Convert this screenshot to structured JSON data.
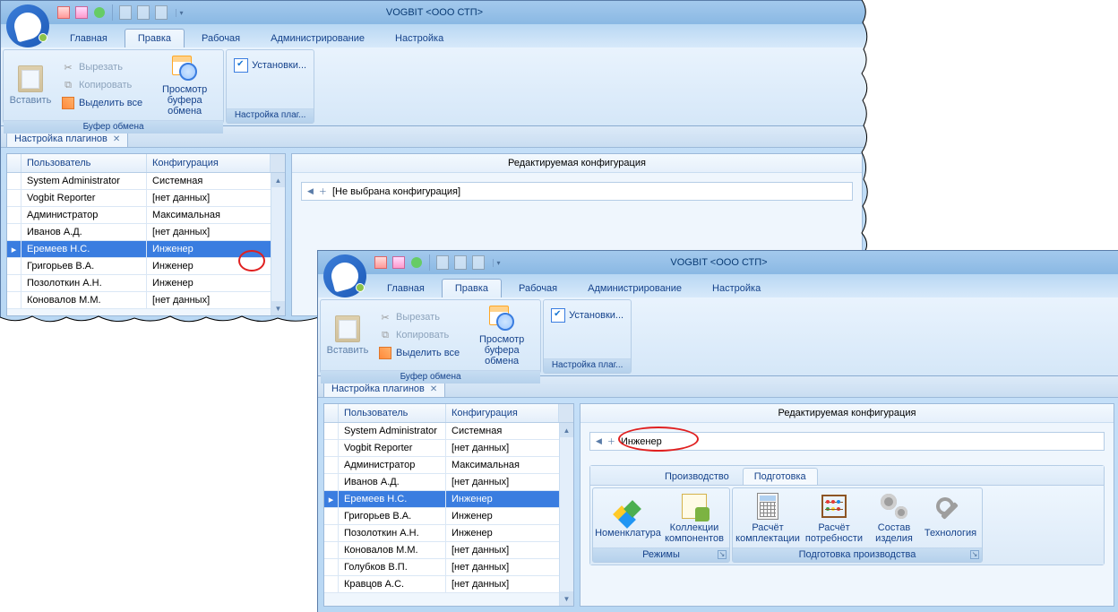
{
  "app_title": "VOGBIT <ООО СТП>",
  "main_tabs": [
    "Главная",
    "Правка",
    "Рабочая",
    "Администрирование",
    "Настройка"
  ],
  "active_main_tab": "Правка",
  "ribbon": {
    "paste": "Вставить",
    "cut": "Вырезать",
    "copy": "Копировать",
    "select_all": "Выделить все",
    "clipboard_group": "Буфер обмена",
    "preview": "Просмотр буфера обмена",
    "settings_btn": "Установки...",
    "settings_group": "Настройка плаг..."
  },
  "doc_tab": "Настройка плагинов",
  "grid": {
    "col_user": "Пользователь",
    "col_conf": "Конфигурация",
    "rows_w1": [
      {
        "user": "System Administrator",
        "conf": "Системная"
      },
      {
        "user": "Vogbit Reporter",
        "conf": "[нет данных]"
      },
      {
        "user": "Администратор",
        "conf": "Максимальная"
      },
      {
        "user": "Иванов А.Д.",
        "conf": "[нет данных]"
      },
      {
        "user": "Еремеев Н.С.",
        "conf": "Инженер"
      },
      {
        "user": "Григорьев В.А.",
        "conf": "Инженер"
      },
      {
        "user": "Позолоткин А.Н.",
        "conf": "Инженер"
      },
      {
        "user": "Коновалов М.М.",
        "conf": "[нет данных]"
      }
    ],
    "rows_w2": [
      {
        "user": "System Administrator",
        "conf": "Системная"
      },
      {
        "user": "Vogbit Reporter",
        "conf": "[нет данных]"
      },
      {
        "user": "Администратор",
        "conf": "Максимальная"
      },
      {
        "user": "Иванов А.Д.",
        "conf": "[нет данных]"
      },
      {
        "user": "Еремеев Н.С.",
        "conf": "Инженер"
      },
      {
        "user": "Григорьев В.А.",
        "conf": "Инженер"
      },
      {
        "user": "Позолоткин А.Н.",
        "conf": "Инженер"
      },
      {
        "user": "Коновалов М.М.",
        "conf": "[нет данных]"
      },
      {
        "user": "Голубков В.П.",
        "conf": "[нет данных]"
      },
      {
        "user": "Кравцов А.С.",
        "conf": "[нет данных]"
      }
    ],
    "selected_index": 4
  },
  "right": {
    "title": "Редактируемая конфигурация",
    "empty_text": "[Не выбрана конфигурация]",
    "selected_text": "Инженер"
  },
  "prep": {
    "tabs": [
      "Производство",
      "Подготовка"
    ],
    "active": "Подготовка",
    "buttons": {
      "nomen": "Номенклатура",
      "collections": "Коллекции компонентов",
      "calc_complect": "Расчёт комплектации",
      "calc_need": "Расчёт потребности",
      "composition": "Состав изделия",
      "technology": "Технология"
    },
    "group_modes": "Режимы",
    "group_prep": "Подготовка производства"
  }
}
